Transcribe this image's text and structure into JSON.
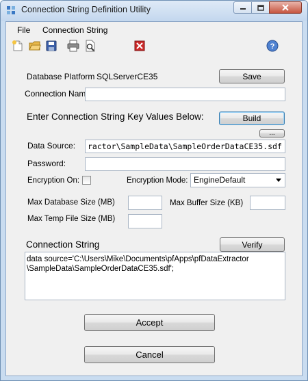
{
  "window": {
    "title": "Connection String Definition Utility"
  },
  "menu": {
    "file": "File",
    "connection_string": "Connection String"
  },
  "toolbar": {
    "icons": [
      "new-file-icon",
      "open-folder-icon",
      "save-icon",
      "print-icon",
      "print-preview-icon",
      "close-red-icon",
      "help-icon"
    ]
  },
  "form": {
    "database_platform_label": "Database Platform",
    "database_platform_value": "SQLServerCE35",
    "save_label": "Save",
    "connection_name_label": "Connection Name",
    "connection_name_value": "",
    "enter_key_values_label": "Enter Connection String Key Values Below:",
    "build_label": "Build",
    "browse_label": "...",
    "data_source_label": "Data Source:",
    "data_source_value": "ractor\\SampleData\\SampleOrderDataCE35.sdf",
    "password_label": "Password:",
    "password_value": "",
    "encryption_on_label": "Encryption On:",
    "encryption_mode_label": "Encryption Mode:",
    "encryption_mode_value": "EngineDefault",
    "max_db_size_label": "Max Database Size (MB)",
    "max_db_size_value": "",
    "max_buffer_size_label": "Max Buffer Size (KB)",
    "max_buffer_size_value": "",
    "max_temp_size_label": "Max Temp File Size (MB)",
    "max_temp_size_value": "",
    "connection_string_label": "Connection String",
    "verify_label": "Verify",
    "connection_string_value": "data source='C:\\Users\\Mike\\Documents\\pfApps\\pfDataExtractor\n\\SampleData\\SampleOrderDataCE35.sdf';",
    "accept_label": "Accept",
    "cancel_label": "Cancel"
  },
  "colors": {
    "title_bar": "#c9dcf0",
    "close_button": "#c7553f",
    "focus_border": "#3c7fb1"
  }
}
